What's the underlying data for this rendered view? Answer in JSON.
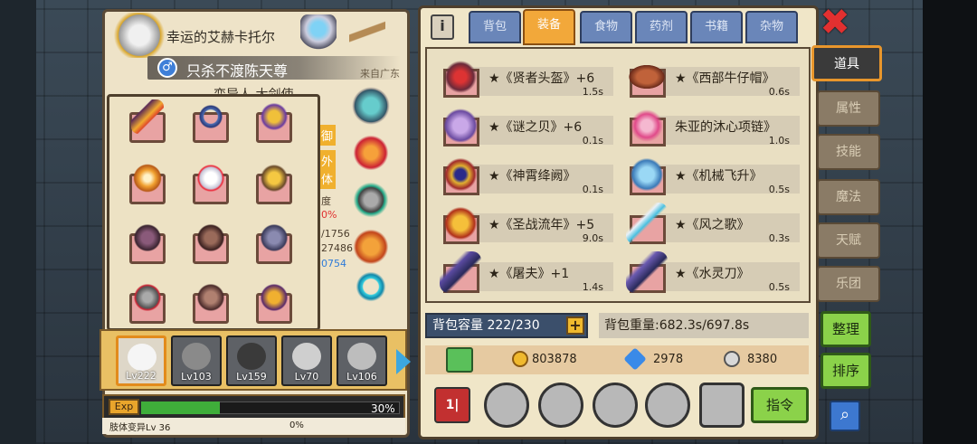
{
  "character": {
    "name": "幸运的艾赫卡托尔",
    "guild": "只杀不渡陈天尊",
    "from": "来自广东",
    "subtitle": "变异人 大剑使",
    "stats_peek": [
      "御",
      "外",
      "体",
      "度",
      "0%",
      "/1756",
      "27486",
      "0754"
    ]
  },
  "heroes": [
    {
      "level": "Lv222",
      "active": true
    },
    {
      "level": "Lv103"
    },
    {
      "level": "Lv159"
    },
    {
      "level": "Lv70"
    },
    {
      "level": "Lv106"
    }
  ],
  "exp": {
    "tag": "Exp",
    "percent": "30%",
    "sub_label": "肢体变异Lv 36",
    "sub_percent": "0%"
  },
  "tabs": [
    "背包",
    "装备",
    "食物",
    "药剂",
    "书籍",
    "杂物"
  ],
  "active_tab": "装备",
  "items": [
    {
      "name": "★《贤者头盔》+6",
      "weight": "1.5s"
    },
    {
      "name": "★《西部牛仔帽》",
      "weight": "0.6s"
    },
    {
      "name": "★《谜之贝》+6",
      "weight": "0.1s"
    },
    {
      "name": "朱亚的沐心项链》",
      "weight": "1.0s"
    },
    {
      "name": "★《神霄绛阙》",
      "weight": "0.1s"
    },
    {
      "name": "★《机械飞升》",
      "weight": "0.5s"
    },
    {
      "name": "★《圣战流年》+5",
      "weight": "9.0s"
    },
    {
      "name": "★《风之歌》",
      "weight": "0.3s"
    },
    {
      "name": "★《屠夫》+1",
      "weight": "1.4s"
    },
    {
      "name": "★《水灵刀》",
      "weight": "0.5s"
    }
  ],
  "bag": {
    "capacity": "背包容量 222/230",
    "weight": "背包重量:682.3s/697.8s"
  },
  "currency": {
    "gold": "803878",
    "diamond": "2978",
    "silver": "8380"
  },
  "command_label": "指令",
  "side_tabs": [
    "道具",
    "属性",
    "技能",
    "魔法",
    "天赋",
    "乐团"
  ],
  "side_buttons": {
    "organize": "整理",
    "sort": "排序"
  },
  "close_label": "✖",
  "colors": {
    "accent": "#f2a83a",
    "tab": "#6a86b9",
    "green": "#8bd24a",
    "close": "#e23030"
  }
}
